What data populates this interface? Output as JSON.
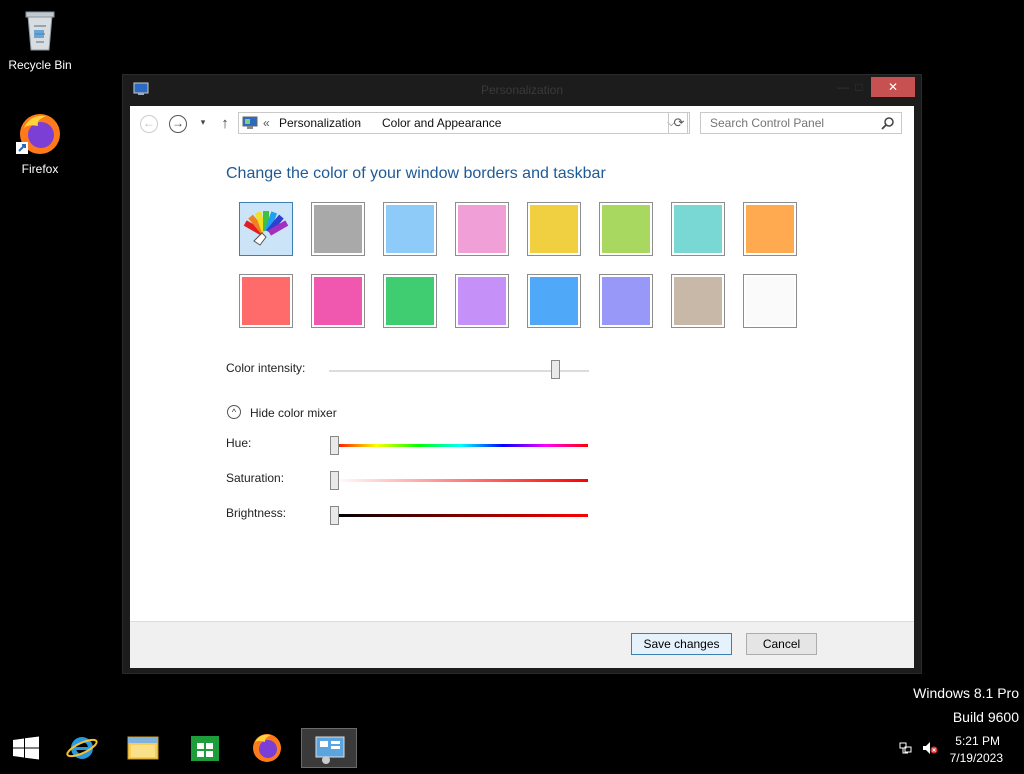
{
  "desktop": {
    "icons": [
      {
        "label": "Recycle Bin",
        "icon": "recycle-bin-icon"
      },
      {
        "label": "Firefox",
        "icon": "firefox-icon"
      }
    ]
  },
  "window": {
    "title": "Personalization",
    "close_glyph": "✕",
    "minimize_glyph": "—",
    "maximize_glyph": "□"
  },
  "nav": {
    "back_glyph": "←",
    "forward_glyph": "→",
    "recent_glyph": "▾",
    "up_glyph": "↑",
    "refresh_glyph": "⟳"
  },
  "address": {
    "overflow": "«",
    "crumbs": [
      "Personalization",
      "Color and Appearance"
    ],
    "separator": "›",
    "dropdown_glyph": "⌵"
  },
  "search": {
    "placeholder": "Search Control Panel"
  },
  "content": {
    "heading": "Change the color of your window borders and taskbar",
    "swatches": [
      {
        "color": "auto",
        "selected": true
      },
      {
        "color": "#a9a9a9"
      },
      {
        "color": "#8ecbf8"
      },
      {
        "color": "#f0a0d6"
      },
      {
        "color": "#f0d040"
      },
      {
        "color": "#a8d860"
      },
      {
        "color": "#7ad8d4"
      },
      {
        "color": "#ffaa50"
      },
      {
        "color": "#ff6a6a"
      },
      {
        "color": "#f058b0"
      },
      {
        "color": "#40cc70"
      },
      {
        "color": "#c590f8"
      },
      {
        "color": "#50a8f8"
      },
      {
        "color": "#9898f8"
      },
      {
        "color": "#c8b8a8"
      },
      {
        "color": "#fafafa"
      }
    ],
    "intensity_label": "Color intensity:",
    "intensity_value": 0.87,
    "mixer_toggle_glyph": "^",
    "mixer_toggle_label": "Hide color mixer",
    "hue_label": "Hue:",
    "saturation_label": "Saturation:",
    "brightness_label": "Brightness:",
    "hue_value": 0,
    "saturation_value": 0,
    "brightness_value": 0
  },
  "footer": {
    "save_label": "Save changes",
    "cancel_label": "Cancel"
  },
  "watermark": {
    "line1": "Windows 8.1 Pro",
    "line2": "Build 9600"
  },
  "taskbar": {
    "items": [
      "start-icon",
      "internet-explorer-icon",
      "file-explorer-icon",
      "store-icon",
      "firefox-icon",
      "control-panel-icon"
    ],
    "time": "5:21 PM",
    "date": "7/19/2023"
  }
}
